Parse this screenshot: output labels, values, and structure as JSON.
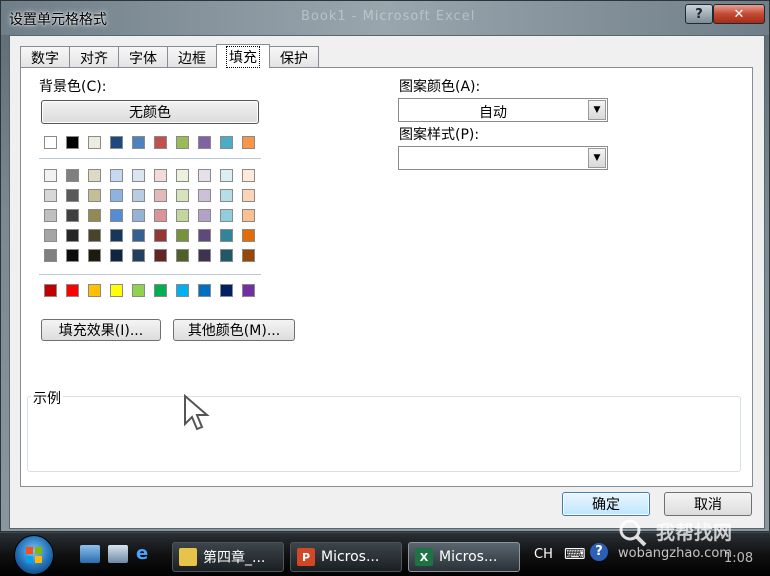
{
  "window": {
    "title": "设置单元格格式",
    "ghost_title": "Book1 - Microsoft Excel"
  },
  "titlebar": {
    "help_label": "?",
    "close_label": "✕"
  },
  "tabs": [
    {
      "label": "数字"
    },
    {
      "label": "对齐"
    },
    {
      "label": "字体"
    },
    {
      "label": "边框"
    },
    {
      "label": "填充",
      "active": true
    },
    {
      "label": "保护"
    }
  ],
  "fill": {
    "bg_label": "背景色(C):",
    "no_color_label": "无颜色",
    "fill_effects_label": "填充效果(I)...",
    "more_colors_label": "其他颜色(M)...",
    "pattern_color_label": "图案颜色(A):",
    "pattern_color_value": "自动",
    "pattern_style_label": "图案样式(P):",
    "pattern_style_value": "",
    "sample_label": "示例",
    "theme_top_row": [
      "#ffffff",
      "#000000",
      "#eeece1",
      "#1f497d",
      "#4f81bd",
      "#c0504d",
      "#9bbb59",
      "#8064a2",
      "#4bacc6",
      "#f79646"
    ],
    "theme_grid": [
      [
        "#f2f2f2",
        "#7f7f7f",
        "#ddd9c3",
        "#c6d9f0",
        "#dbe5f1",
        "#f2dcdb",
        "#ebf1dd",
        "#e5e0ec",
        "#dbeef3",
        "#fdeada"
      ],
      [
        "#d8d8d8",
        "#595959",
        "#c4bd97",
        "#8db3e2",
        "#b8cce4",
        "#e5b9b7",
        "#d7e3bc",
        "#ccc1d9",
        "#b7dde8",
        "#fbd5b5"
      ],
      [
        "#bfbfbf",
        "#3f3f3f",
        "#938953",
        "#548dd4",
        "#95b3d7",
        "#d99694",
        "#c3d69b",
        "#b2a2c7",
        "#92cddc",
        "#fac08f"
      ],
      [
        "#a5a5a5",
        "#262626",
        "#494429",
        "#17365d",
        "#366092",
        "#953734",
        "#76923c",
        "#5f497a",
        "#31859b",
        "#e36c09"
      ],
      [
        "#7f7f7f",
        "#0c0c0c",
        "#1d1b10",
        "#0f243e",
        "#244061",
        "#632423",
        "#4f6128",
        "#3f3151",
        "#205867",
        "#974806"
      ]
    ],
    "standard_row": [
      "#c00000",
      "#ff0000",
      "#ffc000",
      "#ffff00",
      "#92d050",
      "#00b050",
      "#00b0f0",
      "#0070c0",
      "#002060",
      "#7030a0"
    ]
  },
  "buttons": {
    "ok_label": "确定",
    "cancel_label": "取消"
  },
  "taskbar": {
    "items": [
      {
        "label": "第四章_..."
      },
      {
        "label": "Micros..."
      },
      {
        "label": "Micros...",
        "active": true
      }
    ],
    "lang": "CH",
    "watermark_text": "我帮找网",
    "watermark_url": "wobangzhao.com",
    "clock_partial": "1:08"
  }
}
